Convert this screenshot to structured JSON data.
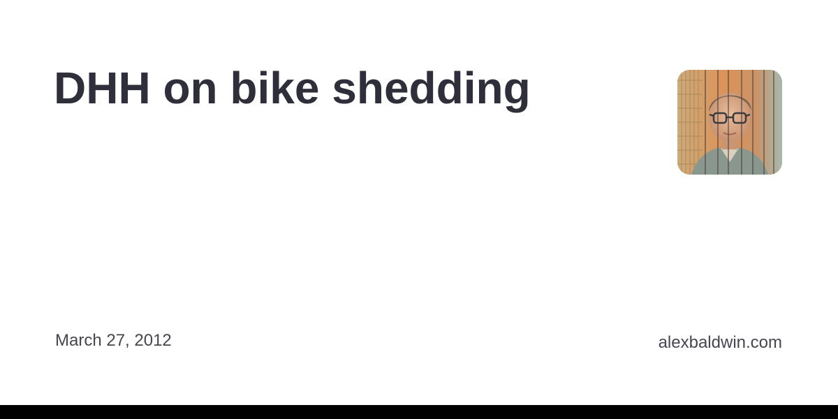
{
  "post": {
    "title": "DHH on bike shedding",
    "date": "March 27, 2012",
    "site": "alexbaldwin.com"
  },
  "avatar": {
    "icon": "author-avatar"
  },
  "colors": {
    "background": "#ffffff",
    "title_text": "#2e2f3b",
    "meta_text": "#46464f",
    "bottom_bar": "#000000"
  }
}
